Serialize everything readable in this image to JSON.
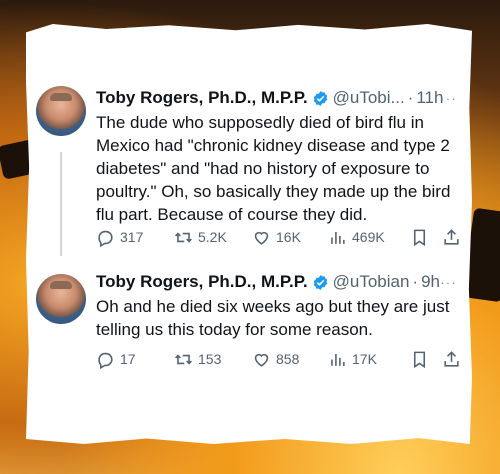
{
  "tweets": [
    {
      "author": "Toby Rogers, Ph.D., M.P.P.",
      "handle": "@uTobi...",
      "time": "11h",
      "more": "···",
      "text": "The dude who supposedly died of bird flu in Mexico had \"chronic kidney disease and type 2 diabetes\" and \"had no history of exposure to poultry.\" Oh, so basically they made up the bird flu part. Because of course they did.",
      "replies": "317",
      "reposts": "5.2K",
      "likes": "16K",
      "views": "469K"
    },
    {
      "author": "Toby Rogers, Ph.D., M.P.P.",
      "handle": "@uTobian",
      "time": "9h",
      "more": "···",
      "text": "Oh and he died six weeks ago but they are just telling us this today for some reason.",
      "replies": "17",
      "reposts": "153",
      "likes": "858",
      "views": "17K"
    }
  ],
  "icons": {
    "verified": "verified-badge-icon",
    "reply": "reply-icon",
    "repost": "repost-icon",
    "like": "heart-icon",
    "views": "views-icon",
    "bookmark": "bookmark-icon",
    "share": "share-icon"
  },
  "colors": {
    "verified": "#1d9bf0",
    "text": "#0f1419",
    "muted": "#536471"
  }
}
